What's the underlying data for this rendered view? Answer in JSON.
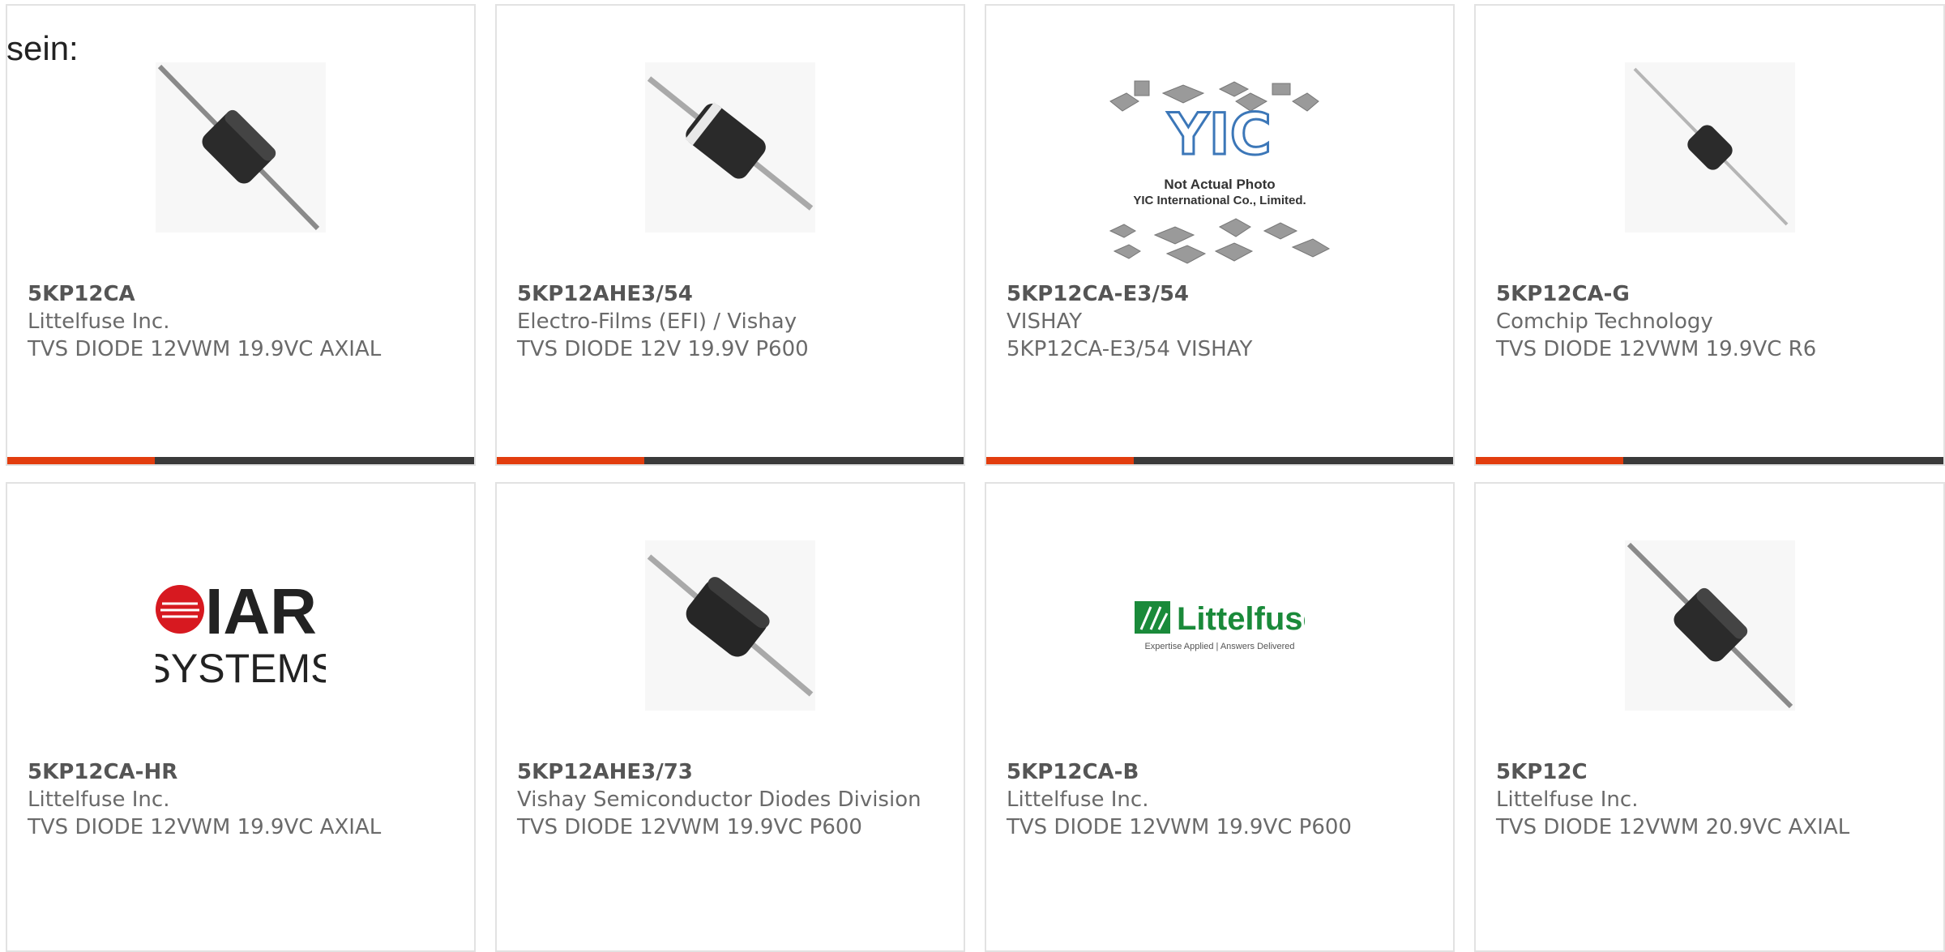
{
  "intro_text": "sein:",
  "colors": {
    "accent": "#e23d0e",
    "bar": "#3a3a3a",
    "text": "#6a6a6a",
    "border": "#e2e2e2"
  },
  "cards": [
    {
      "pn": "5KP12CA",
      "mf": "Littelfuse Inc.",
      "ds": "TVS DIODE 12VWM 19.9VC AXIAL",
      "image": "axial-diode-photo"
    },
    {
      "pn": "5KP12AHE3/54",
      "mf": "Electro-Films (EFI) / Vishay",
      "ds": "TVS DIODE 12V 19.9V P600",
      "image": "axial-diode-band-photo"
    },
    {
      "pn": "5KP12CA-E3/54",
      "mf": "VISHAY",
      "ds": "5KP12CA-E3/54 VISHAY",
      "image": "yic-not-actual-photo",
      "yic": {
        "l1": "Not Actual Photo",
        "l2": "YIC International Co., Limited."
      }
    },
    {
      "pn": "5KP12CA-G",
      "mf": "Comchip Technology",
      "ds": "TVS DIODE 12VWM 19.9VC R6",
      "image": "axial-diode-photo"
    },
    {
      "pn": "5KP12CA-HR",
      "mf": "Littelfuse Inc.",
      "ds": "TVS DIODE 12VWM 19.9VC AXIAL",
      "image": "iar-systems-logo",
      "logo": {
        "l1": "IAR",
        "l2": "SYSTEMS"
      }
    },
    {
      "pn": "5KP12AHE3/73",
      "mf": "Vishay Semiconductor Diodes Division",
      "ds": "TVS DIODE 12VWM 19.9VC P600",
      "image": "axial-diode-photo"
    },
    {
      "pn": "5KP12CA-B",
      "mf": "Littelfuse Inc.",
      "ds": "TVS DIODE 12VWM 19.9VC P600",
      "image": "littelfuse-logo",
      "logo": {
        "l1": "Littelfuse",
        "l2": "Expertise Applied | Answers Delivered"
      }
    },
    {
      "pn": "5KP12C",
      "mf": "Littelfuse Inc.",
      "ds": "TVS DIODE 12VWM 20.9VC AXIAL",
      "image": "axial-diode-photo"
    }
  ]
}
